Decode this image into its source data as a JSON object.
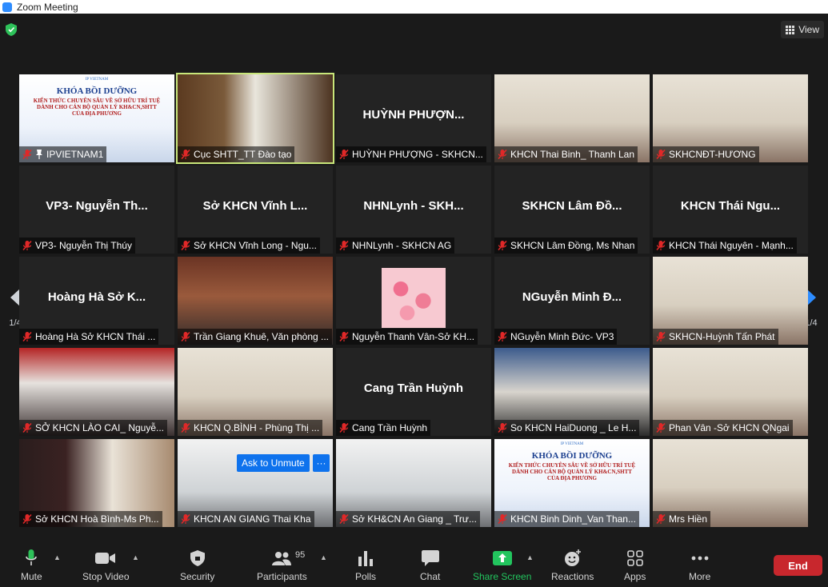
{
  "window": {
    "title": "Zoom Meeting"
  },
  "header": {
    "view_label": "View"
  },
  "pagination": {
    "left": "1/4",
    "right": "1/4"
  },
  "tiles": [
    {
      "label": "IPVIETNAM1",
      "bigname": "",
      "pinned": true
    },
    {
      "label": "Cục SHTT_TT Đào tạo",
      "bigname": "",
      "active": true
    },
    {
      "label": "HUỲNH PHƯỢNG - SKHCN...",
      "bigname": "HUỲNH PHƯỢN..."
    },
    {
      "label": "KHCN Thai Binh_ Thanh Lan",
      "bigname": ""
    },
    {
      "label": "SKHCNĐT-HƯƠNG",
      "bigname": ""
    },
    {
      "label": "VP3- Nguyễn Thị Thúy",
      "bigname": "VP3- Nguyễn Th..."
    },
    {
      "label": "Sở KHCN Vĩnh Long - Ngu...",
      "bigname": "Sở KHCN Vĩnh L..."
    },
    {
      "label": "NHNLynh - SKHCN AG",
      "bigname": "NHNLynh - SKH..."
    },
    {
      "label": "SKHCN Lâm Đồng, Ms Nhan",
      "bigname": "SKHCN Lâm Đồ..."
    },
    {
      "label": "KHCN Thái Nguyên - Mạnh...",
      "bigname": "KHCN Thái Ngu..."
    },
    {
      "label": "Hoàng Hà Sở KHCN Thái ...",
      "bigname": "Hoàng Hà Sở K..."
    },
    {
      "label": "Trần Giang Khuê, Văn phòng ...",
      "bigname": ""
    },
    {
      "label": "Nguyễn Thanh Vân-Sở KH...",
      "bigname": ""
    },
    {
      "label": "NGuyễn Minh Đức- VP3",
      "bigname": "NGuyễn Minh Đ..."
    },
    {
      "label": "SKHCN-Huỳnh Tấn Phát",
      "bigname": ""
    },
    {
      "label": "SỞ KHCN LÀO CAI_ Nguyễ...",
      "bigname": ""
    },
    {
      "label": "KHCN Q.BÌNH - Phùng Thị ...",
      "bigname": ""
    },
    {
      "label": "Cang Trần Huỳnh",
      "bigname": "Cang Trần Huỳnh"
    },
    {
      "label": "So KHCN HaiDuong _ Le H...",
      "bigname": ""
    },
    {
      "label": "Phan Vân -Sở KHCN QNgai",
      "bigname": ""
    },
    {
      "label": "Sở KHCN Hoà Bình-Ms Ph...",
      "bigname": ""
    },
    {
      "label": "KHCN AN GIANG Thai Kha",
      "bigname": ""
    },
    {
      "label": "Sở KH&CN An Giang _ Trư...",
      "bigname": ""
    },
    {
      "label": "KHCN Binh Dinh_Van Than...",
      "bigname": ""
    },
    {
      "label": "Mrs Hiền",
      "bigname": ""
    }
  ],
  "slide_text": {
    "brand": "IP VIETNAM",
    "title": "KHÓA BỒI DƯỠNG",
    "line1": "KIẾN THỨC CHUYÊN SÂU VỀ SỞ HỮU TRÍ TUỆ",
    "line2": "DÀNH CHO CÁN BỘ QUẢN LÝ KH&CN,SHTT",
    "line3": "CỦA ĐỊA PHƯƠNG"
  },
  "hover": {
    "ask_unmute": "Ask to Unmute",
    "more": "···"
  },
  "toolbar": {
    "mute": "Mute",
    "stop_video": "Stop Video",
    "security": "Security",
    "participants": "Participants",
    "participants_count": "95",
    "polls": "Polls",
    "chat": "Chat",
    "share_screen": "Share Screen",
    "reactions": "Reactions",
    "apps": "Apps",
    "more": "More",
    "end": "End"
  },
  "colors": {
    "active_speaker": "#c8e67a",
    "share_green": "#22c55e",
    "end_red": "#c8272d",
    "blue": "#0e72ed"
  }
}
